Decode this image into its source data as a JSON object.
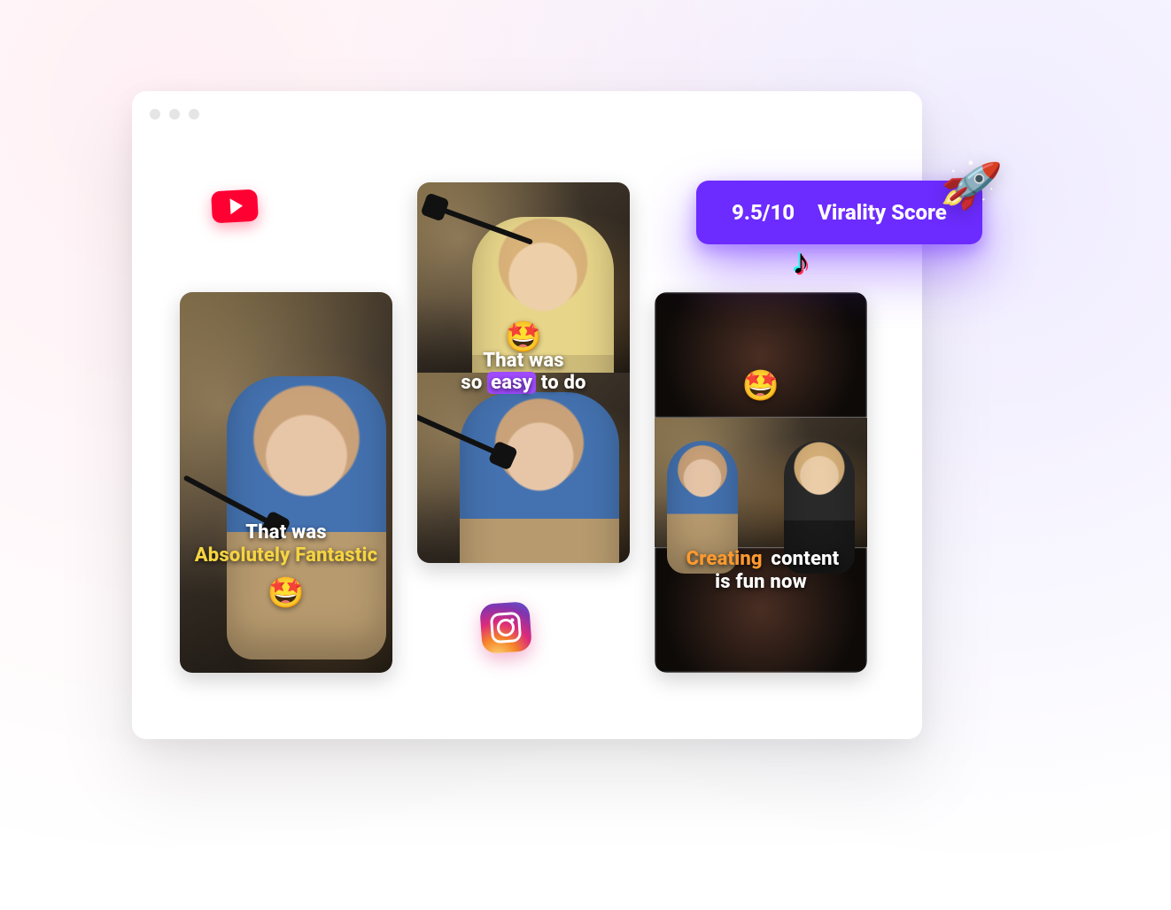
{
  "virality": {
    "score_text": "9.5/10",
    "label": "Virality Score",
    "emoji": "🚀"
  },
  "icons": {
    "youtube": "youtube",
    "instagram": "instagram",
    "tiktok_glyph": "♪"
  },
  "clips": [
    {
      "caption_line1": "That was",
      "caption_highlight": "Absolutely Fantastic",
      "highlight_color": "#f5d442",
      "emoji": "🤩"
    },
    {
      "caption_line1": "That was",
      "caption_line2_pre": "so ",
      "caption_highlight": "easy",
      "caption_line2_post": " to do",
      "highlight_bg": "#a04bff",
      "emoji": "🤩"
    },
    {
      "caption_highlight": "Creating",
      "caption_line1_post": " content",
      "caption_line2": "is fun now",
      "highlight_color": "#ff9a2e",
      "emoji": "🤩"
    }
  ]
}
